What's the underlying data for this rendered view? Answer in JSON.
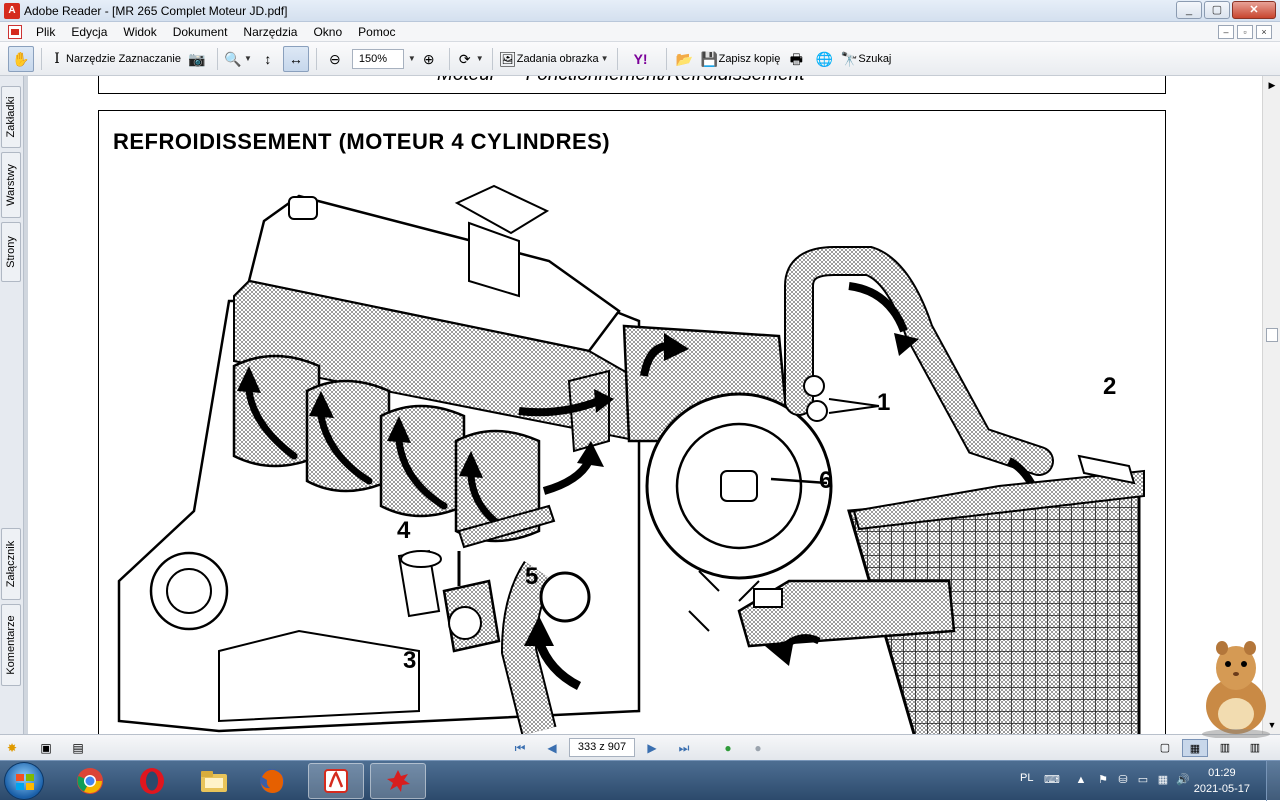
{
  "window": {
    "title": "Adobe Reader - [MR 265 Complet Moteur JD.pdf]",
    "app_icon_glyph": "A",
    "minimize": "_",
    "maximize": "▢",
    "close": "✕"
  },
  "menu": {
    "items": [
      "Plik",
      "Edycja",
      "Widok",
      "Dokument",
      "Narzędzia",
      "Okno",
      "Pomoc"
    ],
    "mdi_min": "–",
    "mdi_max": "▫",
    "mdi_close": "×"
  },
  "toolbar": {
    "select_tool_label": "Narzędzie Zaznaczanie",
    "zoom_value": "150%",
    "image_tasks_label": "Zadania obrazka",
    "save_copy_label": "Zapisz kopię",
    "search_label": "Szukaj"
  },
  "left_panel": {
    "tabs_top": [
      "Zakładki",
      "Warstwy",
      "Strony"
    ],
    "tabs_bottom": [
      "Załącznik",
      "Komentarze"
    ]
  },
  "document": {
    "header_text": "Moteur — Fonctionnement/Refroidissement",
    "figure_title": "REFROIDISSEMENT (MOTEUR 4 CYLINDRES)",
    "callouts": [
      "1",
      "2",
      "3",
      "4",
      "5",
      "6"
    ]
  },
  "status": {
    "page_indicator": "333 z 907"
  },
  "taskbar": {
    "apps": [
      "chrome-icon",
      "opera-icon",
      "explorer-icon",
      "firefox-icon",
      "adobe-reader-icon",
      "app-splat-icon"
    ],
    "lang": "PL",
    "time": "01:29",
    "date": "2021-05-17"
  },
  "colors": {
    "title_gradient": "#d4e0ef",
    "taskbar": "#2c4a6c",
    "accent_red": "#d52b1e"
  }
}
